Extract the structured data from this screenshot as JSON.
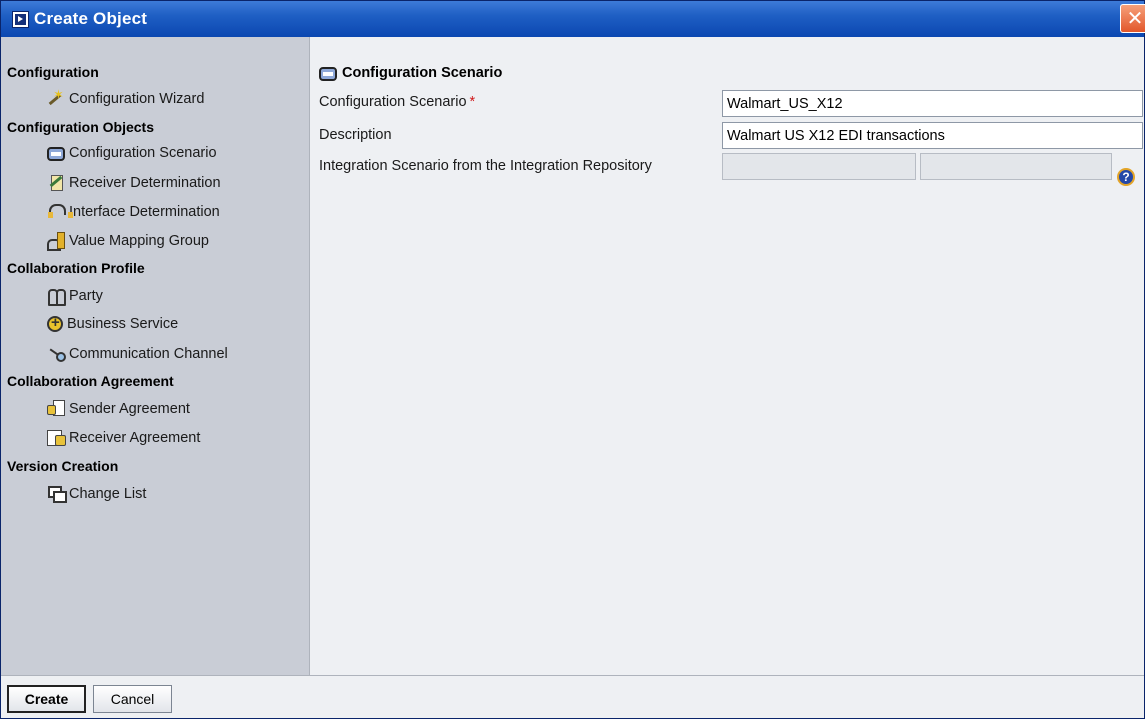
{
  "window": {
    "title": "Create Object",
    "close_label": "✕"
  },
  "sidebar": {
    "groups": [
      {
        "label": "Configuration"
      },
      {
        "label": "Configuration Objects"
      },
      {
        "label": "Collaboration Profile"
      },
      {
        "label": "Collaboration Agreement"
      },
      {
        "label": "Version Creation"
      }
    ],
    "items": [
      {
        "label": "Configuration Wizard",
        "icon": "wizard-wand-icon"
      },
      {
        "label": "Configuration Scenario",
        "icon": "configuration-scenario-icon"
      },
      {
        "label": "Receiver Determination",
        "icon": "receiver-determination-icon"
      },
      {
        "label": "Interface Determination",
        "icon": "interface-determination-icon"
      },
      {
        "label": "Value Mapping Group",
        "icon": "value-mapping-group-icon"
      },
      {
        "label": "Party",
        "icon": "party-icon"
      },
      {
        "label": "Business Service",
        "icon": "business-service-icon"
      },
      {
        "label": "Communication Channel",
        "icon": "communication-channel-icon"
      },
      {
        "label": "Sender Agreement",
        "icon": "sender-agreement-icon"
      },
      {
        "label": "Receiver Agreement",
        "icon": "receiver-agreement-icon"
      },
      {
        "label": "Change List",
        "icon": "change-list-icon"
      }
    ]
  },
  "form": {
    "section_title": "Configuration Scenario",
    "scenario_label": "Configuration Scenario",
    "required_marker": "*",
    "scenario_value": "Walmart_US_X12",
    "description_label": "Description",
    "description_value": "Walmart US X12 EDI transactions",
    "integration_label": "Integration Scenario from the Integration Repository",
    "integration_value_1": "",
    "integration_value_2": "",
    "help_glyph": "?"
  },
  "footer": {
    "create_label": "Create",
    "cancel_label": "Cancel"
  },
  "colors": {
    "titlebar": "#0b47b1",
    "sidebar": "#c9cdd6",
    "content": "#eef0f3",
    "required": "#d0191b"
  }
}
